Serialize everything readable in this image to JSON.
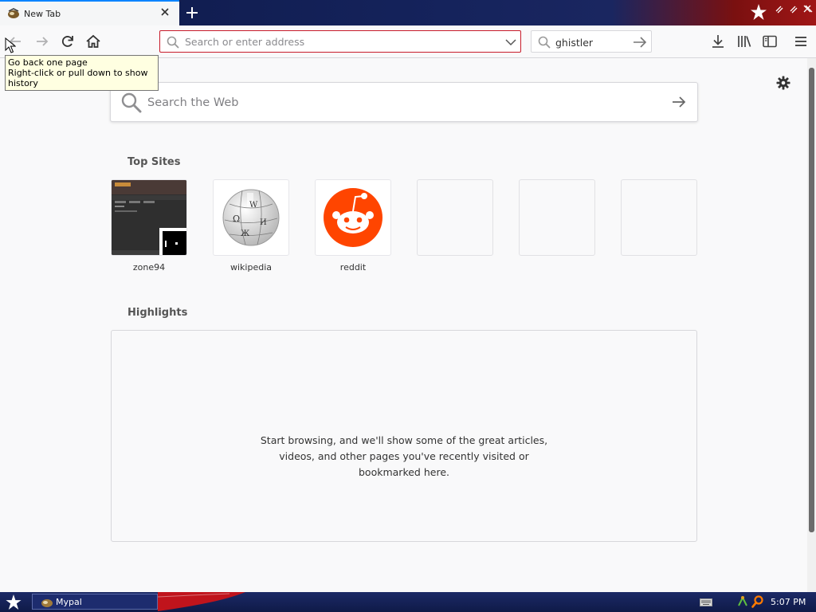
{
  "tab": {
    "title": "New Tab"
  },
  "tooltip": {
    "line1": "Go back one page",
    "line2": "Right-click or pull down to show history"
  },
  "urlbar": {
    "placeholder": "Search or enter address",
    "value": ""
  },
  "searchbar": {
    "value": "ghistler"
  },
  "websearch": {
    "placeholder": "Search the Web"
  },
  "top_sites": {
    "title": "Top Sites",
    "items": [
      {
        "label": "zone94"
      },
      {
        "label": "wikipedia"
      },
      {
        "label": "reddit"
      },
      {
        "label": ""
      },
      {
        "label": ""
      },
      {
        "label": ""
      }
    ]
  },
  "highlights": {
    "title": "Highlights",
    "empty_line1": "Start browsing, and we'll show some of the great articles,",
    "empty_line2": "videos, and other pages you've recently visited or",
    "empty_line3": "bookmarked here."
  },
  "taskbar": {
    "app_label": "Mypal",
    "clock": "5:07 PM"
  },
  "colors": {
    "urlbar_border": "#c71b2a",
    "reddit": "#ff4500",
    "taskbar": "#1c2a66"
  },
  "icons": [
    "back-icon",
    "forward-icon",
    "reload-icon",
    "home-icon",
    "search-icon",
    "dropdown-icon",
    "arrow-right-icon",
    "download-icon",
    "library-icon",
    "sidebar-icon",
    "menu-icon",
    "gear-icon",
    "close-icon",
    "plus-icon",
    "star-icon"
  ]
}
